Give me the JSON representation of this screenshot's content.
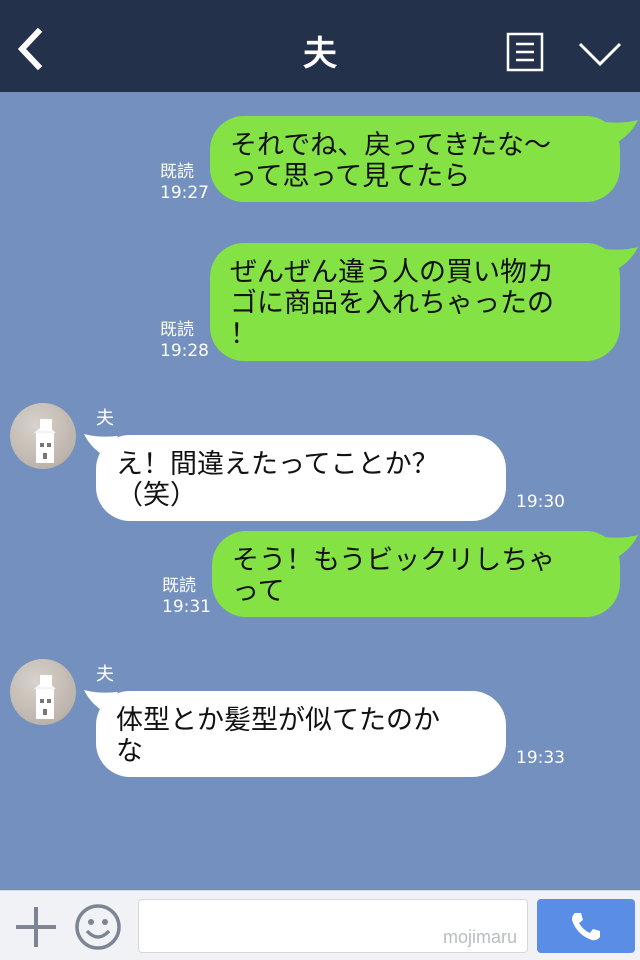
{
  "header": {
    "title": "夫",
    "back_icon": "chevron-left-icon",
    "menu_icon": "list-icon",
    "collapse_icon": "chevron-down-icon",
    "background": "#24314b"
  },
  "chat": {
    "background": "#7390bf",
    "my_bubble_color": "#84e245",
    "their_bubble_color": "#ffffff",
    "messages": [
      {
        "side": "mine",
        "lines": [
          "それでね、戻ってきたな〜",
          "って思って見てたら"
        ],
        "read": "既読",
        "time": "19:27"
      },
      {
        "side": "mine",
        "lines": [
          "ぜんぜん違う人の買い物カ",
          "ゴに商品を入れちゃったの",
          "！"
        ],
        "read": "既読",
        "time": "19:28"
      },
      {
        "side": "theirs",
        "sender": "夫",
        "lines": [
          "え！間違えたってことか？",
          "（笑）"
        ],
        "time": "19:30"
      },
      {
        "side": "mine",
        "lines": [
          "そう！もうビックリしちゃ",
          "って"
        ],
        "read": "既読",
        "time": "19:31"
      },
      {
        "side": "theirs",
        "sender": "夫",
        "lines": [
          "体型とか髪型が似てたのか",
          "な"
        ],
        "time": "19:33"
      }
    ]
  },
  "footer": {
    "plus_icon": "plus-icon",
    "emoji_icon": "smile-icon",
    "input_value": "",
    "watermark": "mojimaru",
    "call_icon": "phone-icon",
    "call_color": "#5a8ee6"
  }
}
